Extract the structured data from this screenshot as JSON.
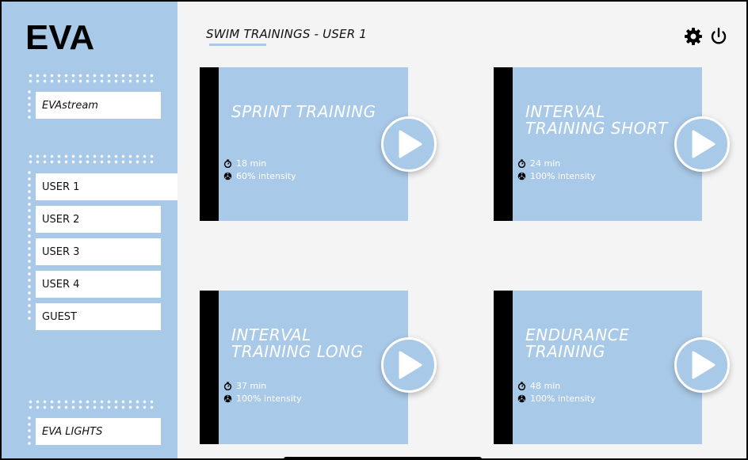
{
  "app": {
    "logo": "EVA"
  },
  "header": {
    "title": "SWIM TRAININGS - USER 1"
  },
  "sidebar": {
    "stream_label": "EVAstream",
    "users": [
      "USER 1",
      "USER 2",
      "USER 3",
      "USER 4",
      "GUEST"
    ],
    "active_user": "USER 1",
    "lights_label": "EVA LIGHTS"
  },
  "trainings": [
    {
      "name": "SPRINT TRAINING",
      "duration": "18 min",
      "intensity": "60% intensity"
    },
    {
      "name": "INTERVAL TRAINING SHORT",
      "duration": "24 min",
      "intensity": "100% intensity"
    },
    {
      "name": "INTERVAL TRAINING LONG",
      "duration": "37 min",
      "intensity": "100% intensity"
    },
    {
      "name": "ENDURANCE TRAINING",
      "duration": "48 min",
      "intensity": "100% intensity"
    }
  ],
  "colors": {
    "accent": "#a9c9e8",
    "background": "#f4f4f4",
    "card_bar": "#000000"
  },
  "icons": [
    "gear-icon",
    "power-icon",
    "play-icon",
    "stopwatch-icon",
    "intensity-icon"
  ]
}
